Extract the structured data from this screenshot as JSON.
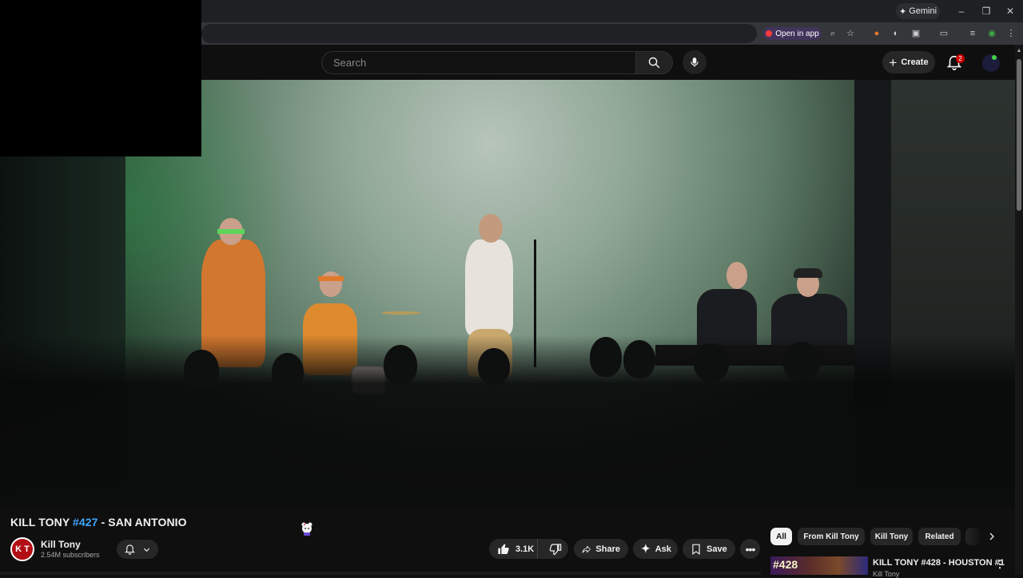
{
  "browser": {
    "gemini_label": "Gemini",
    "open_in_app_label": "Open in app"
  },
  "header": {
    "search_placeholder": "Search",
    "create_label": "Create",
    "notification_count": "2"
  },
  "video": {
    "title_prefix": "KILL TONY ",
    "title_hashtag": "#427",
    "title_suffix": " - SAN ANTONIO"
  },
  "channel": {
    "name": "Kill Tony",
    "subscribers": "2.54M subscribers",
    "avatar_text": "K T"
  },
  "actions": {
    "like_count": "3.1K",
    "share_label": "Share",
    "ask_label": "Ask",
    "save_label": "Save"
  },
  "chips": [
    {
      "label": "All",
      "active": true
    },
    {
      "label": "From Kill Tony",
      "active": false
    },
    {
      "label": "Kill Tony",
      "active": false
    },
    {
      "label": "Related",
      "active": false
    }
  ],
  "recommendation": {
    "thumb_text": "#428",
    "title": "KILL TONY #428 - HOUSTON #1",
    "channel": "Kill Tony"
  },
  "colors": {
    "accent_link": "#3ea6ff",
    "notification_badge": "#cc0000",
    "channel_avatar": "#b10f14"
  }
}
